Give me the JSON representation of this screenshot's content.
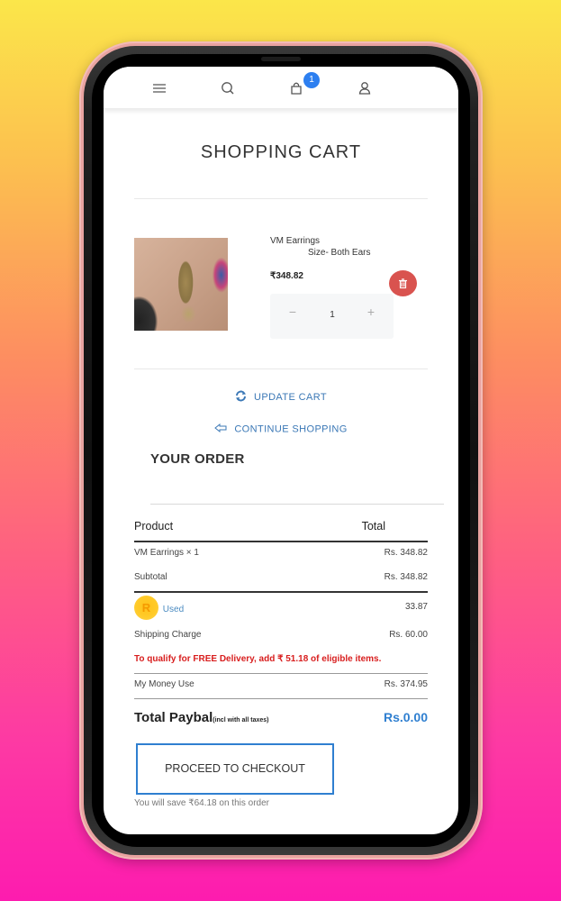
{
  "header": {
    "cart_badge_count": "1",
    "icons": [
      "menu-icon",
      "search-icon",
      "shopping-bag-icon",
      "user-icon"
    ]
  },
  "page": {
    "title": "SHOPPING CART"
  },
  "cart_items": [
    {
      "name": "VM Earrings",
      "size": "Size- Both Ears",
      "price": "₹348.82",
      "quantity": "1",
      "minus_label": "−",
      "plus_label": "+"
    }
  ],
  "actions": {
    "update_cart": "UPDATE CART",
    "continue_shopping": "CONTINUE SHOPPING"
  },
  "order": {
    "heading": "YOUR ORDER",
    "columns": [
      "Product",
      "Total"
    ],
    "rows": [
      {
        "label": "VM Earrings × 1",
        "value": "Rs. 348.82"
      },
      {
        "label": "Subtotal",
        "value": "Rs. 348.82"
      }
    ],
    "coin": {
      "symbol": "R",
      "label": "Used",
      "value": "33.87"
    },
    "shipping": {
      "label": "Shipping Charge",
      "value": "Rs. 60.00"
    },
    "free_delivery_notice": "To qualify for FREE Delivery, add ₹ 51.18 of eligible items.",
    "my_money": {
      "label": "My Money Use",
      "value": "Rs. 374.95"
    },
    "total": {
      "label": "Total Paybal",
      "note": "(incl with all taxes)",
      "value": "Rs.0.00"
    },
    "checkout_label": "PROCEED TO CHECKOUT",
    "save_note": "You will save ₹64.18 on this order"
  },
  "colors": {
    "accent_blue": "#2f7fd0",
    "link_blue": "#3b78b6",
    "delete_red": "#d9534f",
    "warning_red": "#d81e1e",
    "coin_yellow": "#ffc21a",
    "phone_frame": "#e9a3a0"
  }
}
